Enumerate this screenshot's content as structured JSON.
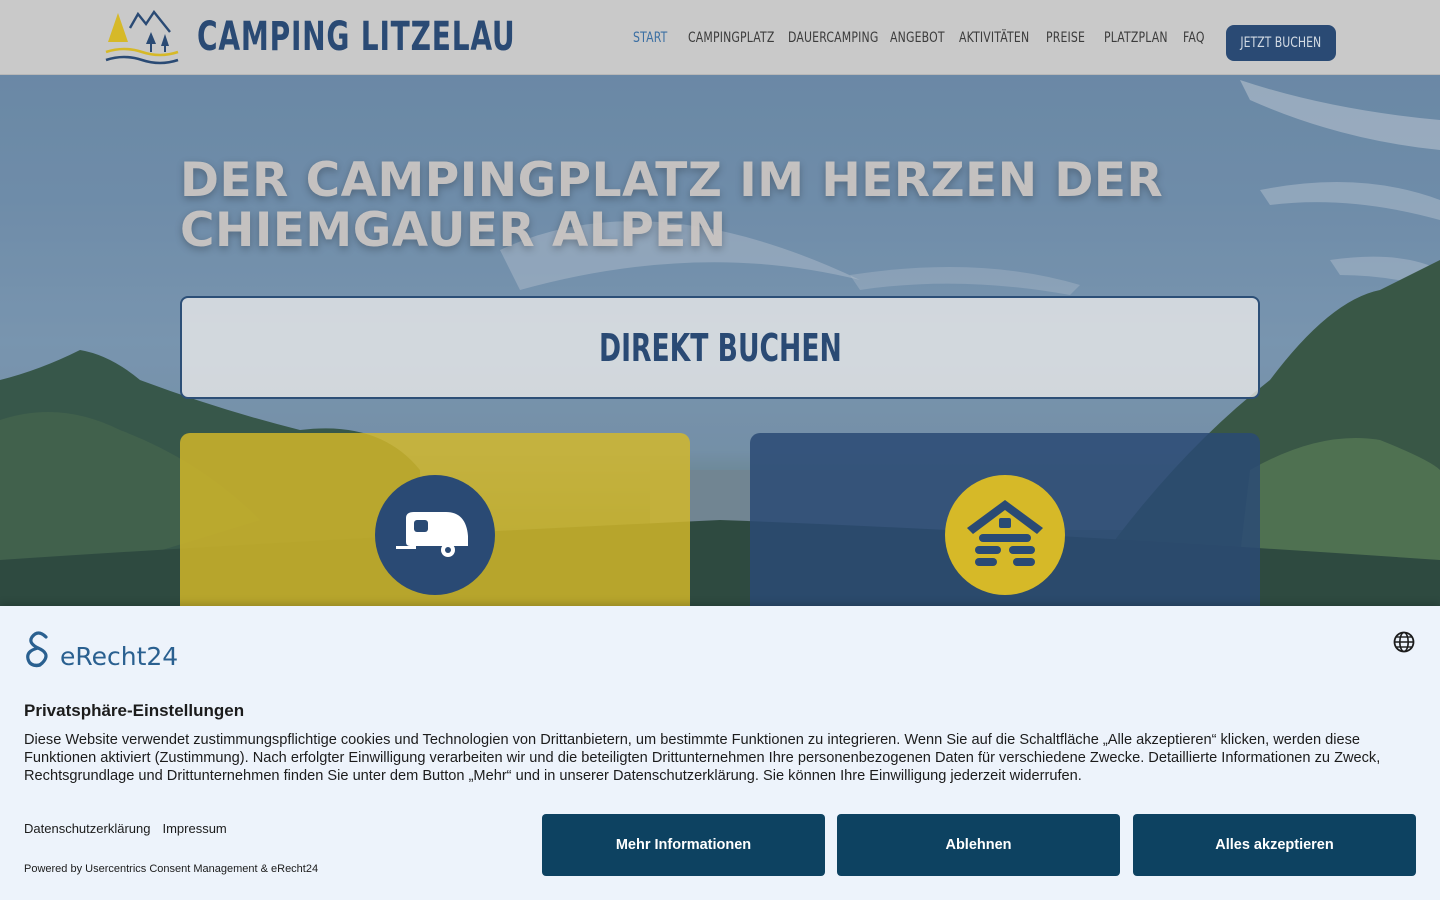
{
  "header": {
    "brand": "CAMPING LITZELAU",
    "nav": [
      {
        "label": "START",
        "active": true
      },
      {
        "label": "CAMPINGPLATZ",
        "active": false
      },
      {
        "label": "DAUERCAMPING",
        "active": false
      },
      {
        "label": "ANGEBOT",
        "active": false
      },
      {
        "label": "AKTIVITÄTEN",
        "active": false
      },
      {
        "label": "PREISE",
        "active": false
      },
      {
        "label": "PLATZPLAN",
        "active": false
      },
      {
        "label": "FAQ",
        "active": false
      }
    ],
    "book_button": "JETZT BUCHEN"
  },
  "hero": {
    "title_line1": "DER CAMPINGPLATZ IM HERZEN DER",
    "title_line2": "CHIEMGAUER ALPEN",
    "direct_booking": "DIREKT BUCHEN",
    "tiles": [
      {
        "icon": "caravan-icon",
        "color": "#d6b928"
      },
      {
        "icon": "log-cabin-icon",
        "color": "#2a4a74"
      }
    ]
  },
  "cookie": {
    "logo_text": "eRecht24",
    "title": "Privatsphäre-Einstellungen",
    "text": "Diese Website verwendet zustimmungspflichtige cookies und Technologien von Drittanbietern, um bestimmte Funktionen zu integrieren. Wenn Sie auf die Schaltfläche „Alle akzeptieren“ klicken, werden diese Funktionen aktiviert (Zustimmung). Nach erfolgter Einwilligung verarbeiten wir und die beteiligten Drittunternehmen Ihre personenbezogenen Daten für verschiedene Zwecke. Detaillierte Informationen zu Zweck, Rechtsgrundlage und Drittunternehmen finden Sie unter dem Button „Mehr“ und in unserer Datenschutzerklärung. Sie können Ihre Einwilligung jederzeit widerrufen.",
    "link_privacy": "Datenschutzerklärung",
    "link_imprint": "Impressum",
    "powered_by": "Powered by Usercentrics Consent Management & eRecht24",
    "btn_more": "Mehr Informationen",
    "btn_decline": "Ablehnen",
    "btn_accept": "Alles akzeptieren"
  },
  "colors": {
    "brand_blue": "#2a4a74",
    "brand_yellow": "#d6b928",
    "nav_active": "#3b6fa3",
    "consent_button": "#0d4261"
  }
}
